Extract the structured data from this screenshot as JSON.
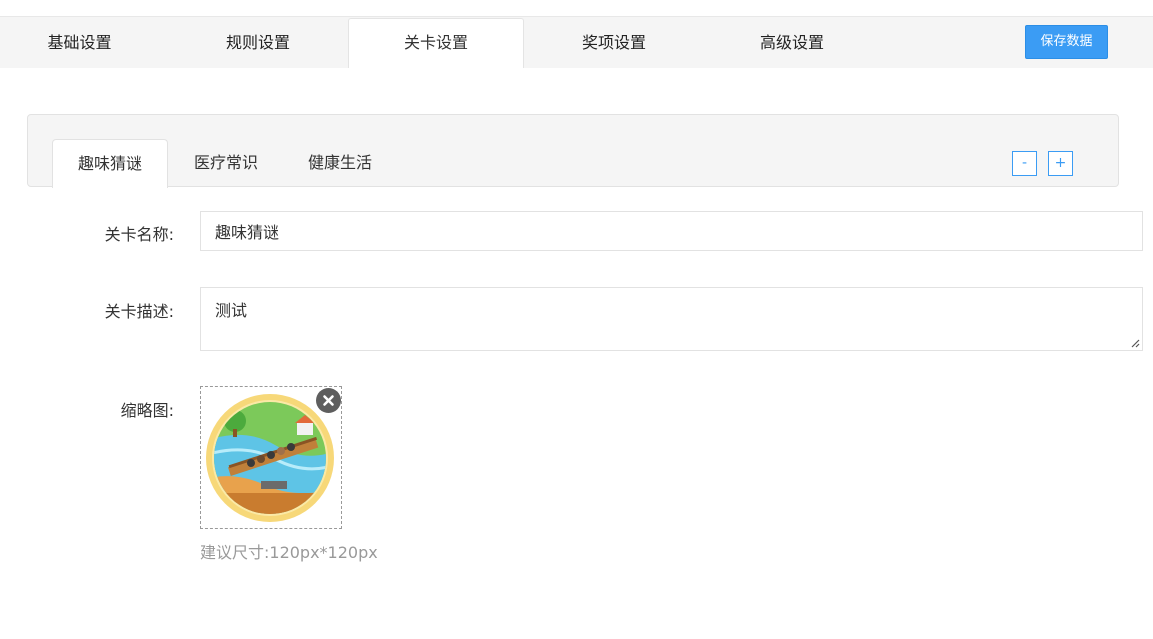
{
  "top_nav": {
    "tabs": [
      {
        "label": "基础设置"
      },
      {
        "label": "规则设置"
      },
      {
        "label": "关卡设置"
      },
      {
        "label": "奖项设置"
      },
      {
        "label": "高级设置"
      }
    ],
    "active_index": 2,
    "save_label": "保存数据"
  },
  "level_tabs": {
    "tabs": [
      {
        "label": "趣味猜谜"
      },
      {
        "label": "医疗常识"
      },
      {
        "label": "健康生活"
      }
    ],
    "active_index": 0,
    "remove_label": "-",
    "add_label": "+"
  },
  "form": {
    "name_label": "关卡名称:",
    "name_value": "趣味猜谜",
    "desc_label": "关卡描述:",
    "desc_value": "测试",
    "thumb_label": "缩略图:",
    "thumb_hint": "建议尺寸:120px*120px"
  },
  "colors": {
    "accent": "#3b9cf4",
    "nav_bg": "#f5f5f5",
    "border": "#e2e2e2",
    "hint": "#999999"
  },
  "icons": {
    "remove": "close-icon",
    "resize": "resize-grip-icon"
  }
}
